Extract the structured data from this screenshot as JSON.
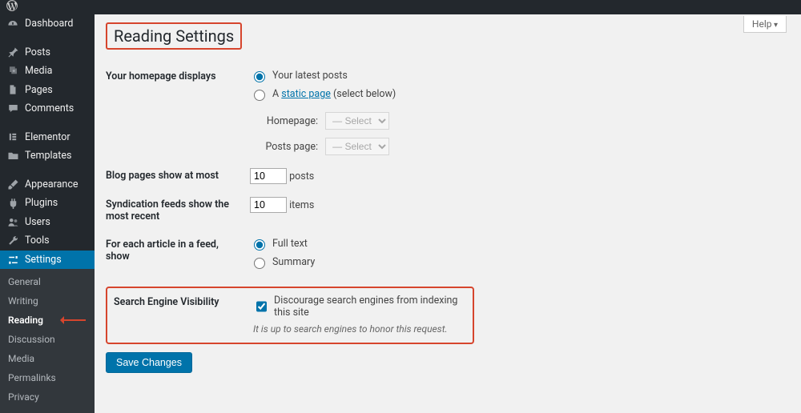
{
  "adminbar": {
    "logo_title": "WordPress"
  },
  "sidebar": {
    "items": [
      {
        "label": "Dashboard"
      },
      {
        "label": "Posts"
      },
      {
        "label": "Media"
      },
      {
        "label": "Pages"
      },
      {
        "label": "Comments"
      },
      {
        "label": "Elementor"
      },
      {
        "label": "Templates"
      },
      {
        "label": "Appearance"
      },
      {
        "label": "Plugins"
      },
      {
        "label": "Users"
      },
      {
        "label": "Tools"
      },
      {
        "label": "Settings"
      }
    ],
    "submenu": [
      {
        "label": "General"
      },
      {
        "label": "Writing"
      },
      {
        "label": "Reading"
      },
      {
        "label": "Discussion"
      },
      {
        "label": "Media"
      },
      {
        "label": "Permalinks"
      },
      {
        "label": "Privacy"
      }
    ]
  },
  "help_label": "Help",
  "page_title": "Reading Settings",
  "fields": {
    "homepage": {
      "label": "Your homepage displays",
      "opt_latest": "Your latest posts",
      "opt_static_prefix": "A ",
      "opt_static_link": "static page",
      "opt_static_suffix": " (select below)",
      "homepage_label": "Homepage:",
      "posts_page_label": "Posts page:",
      "select_placeholder": "— Select —"
    },
    "blog_pages": {
      "label": "Blog pages show at most",
      "value": "10",
      "suffix": "posts"
    },
    "syndication": {
      "label": "Syndication feeds show the most recent",
      "value": "10",
      "suffix": "items"
    },
    "feed_article": {
      "label": "For each article in a feed, show",
      "opt_full": "Full text",
      "opt_summary": "Summary"
    },
    "sev": {
      "label": "Search Engine Visibility",
      "checkbox_label": "Discourage search engines from indexing this site",
      "desc": "It is up to search engines to honor this request."
    }
  },
  "save_button": "Save Changes"
}
